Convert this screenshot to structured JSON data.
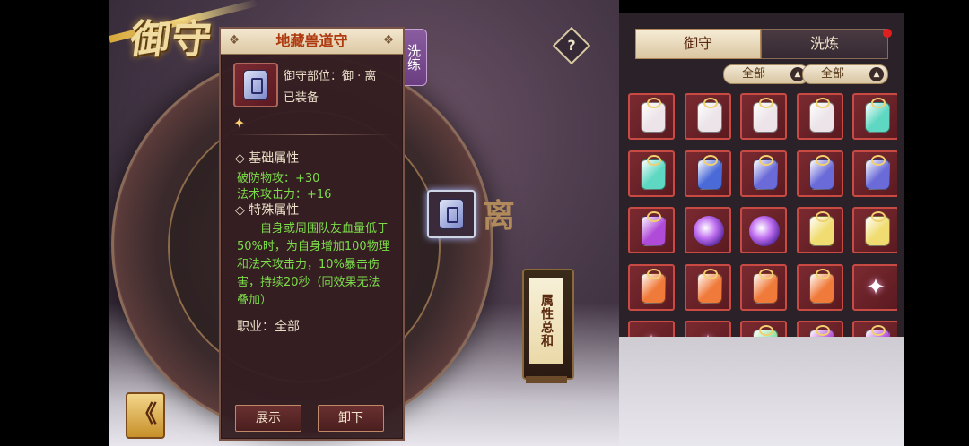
{
  "page_title": "御守",
  "help_icon": "?",
  "wash_tab": "洗练",
  "detail": {
    "name": "地藏兽道守",
    "prev_icon": "❖",
    "next_icon": "❖",
    "slot_info": "御守部位：御 · 离",
    "equipped": "已装备",
    "basic_title": "◇ 基础属性",
    "basic_stats": [
      "破防物攻：+30",
      "法术攻击力：+16"
    ],
    "special_title": "◇ 特殊属性",
    "special_text": "自身或周围队友血量低于50%时，为自身增加100物理和法术攻击力，10%暴击伤害，持续20秒（同效果无法叠加）",
    "job": "职业：全部",
    "btn_show": "展示",
    "btn_unequip": "卸下"
  },
  "center_slot_char": "离",
  "lantern_text": "属性总和",
  "back_icon": "《",
  "tabs": {
    "active": "御守",
    "other": "洗炼"
  },
  "filters": [
    {
      "label": "全部",
      "icon": "▲"
    },
    {
      "label": "全部",
      "icon": "▲"
    }
  ],
  "inventory": [
    [
      "white",
      "white",
      "white",
      "white",
      "teal"
    ],
    [
      "teal",
      "blue",
      "blue-purple",
      "blue-purple",
      "blue-purple"
    ],
    [
      "purple",
      "swirl",
      "swirl",
      "yellow",
      "yellow"
    ],
    [
      "orange",
      "orange",
      "orange",
      "orange",
      "star"
    ],
    [
      "star",
      "star",
      "green",
      "purple",
      "purple"
    ]
  ],
  "colors": {
    "white": "#ece4e8",
    "teal": "#5ed8c2",
    "blue": "#4a6ad8",
    "blue-purple": "#6a6ad8",
    "purple": "#b04ad8",
    "swirl": "#c070f0",
    "yellow": "#f0dc70",
    "orange": "#f07a3a",
    "green": "#8ae0a0",
    "star": "#ffffff"
  }
}
